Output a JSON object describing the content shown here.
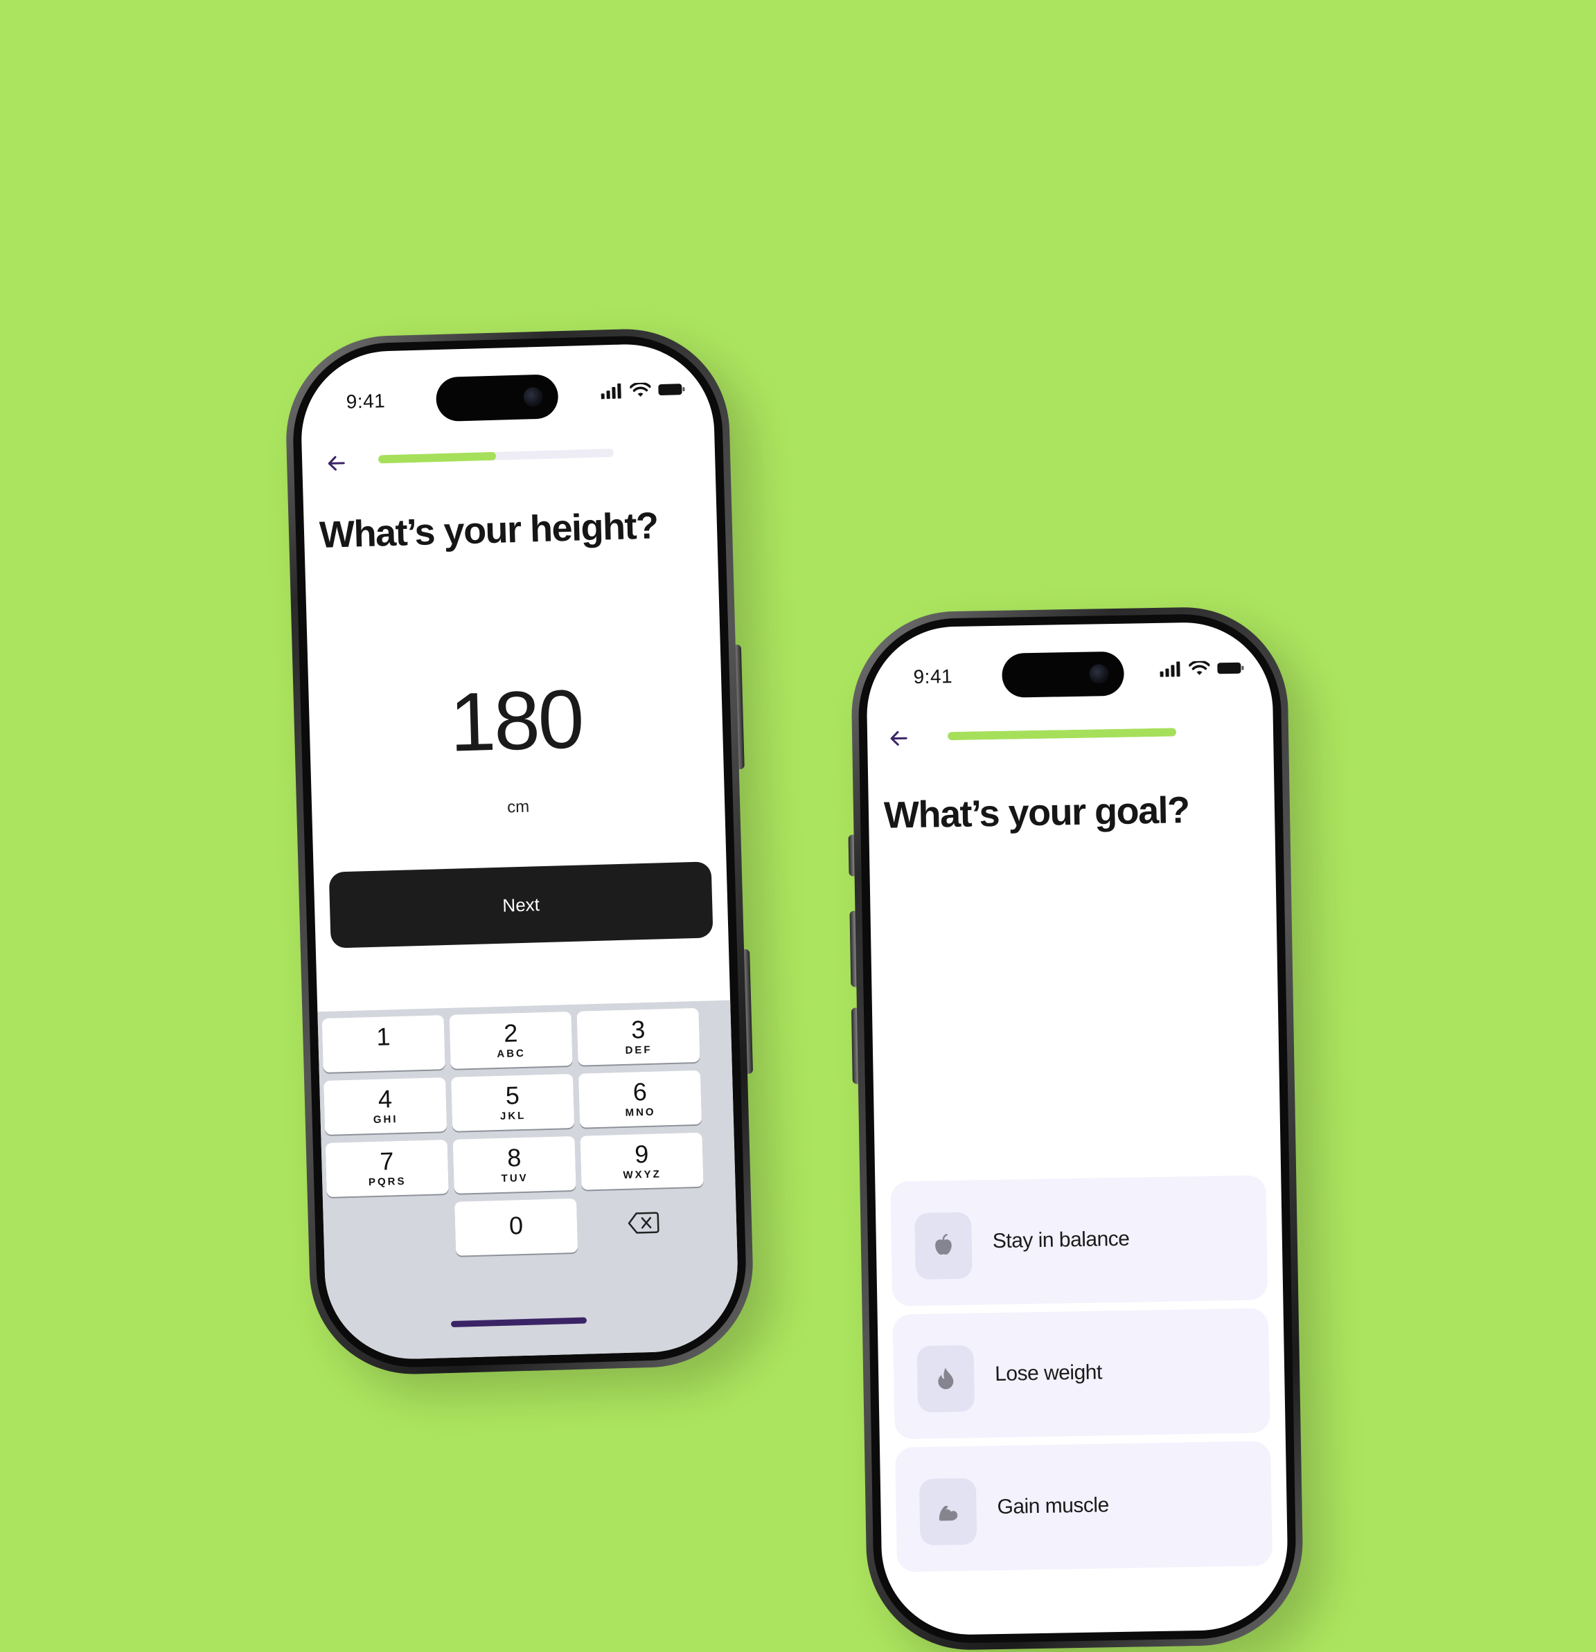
{
  "colors": {
    "background": "#abe45e",
    "accent": "#a6e05a",
    "button": "#1c1c1c",
    "option_bg": "#f3f2fd",
    "home_indicator": "#3b2466"
  },
  "phone_height": {
    "status": {
      "time": "9:41"
    },
    "progress": 0.5,
    "title": "What’s your height?",
    "value": "180",
    "unit": "cm",
    "next_label": "Next",
    "keypad": [
      {
        "num": "1",
        "letters": ""
      },
      {
        "num": "2",
        "letters": "ABC"
      },
      {
        "num": "3",
        "letters": "DEF"
      },
      {
        "num": "4",
        "letters": "GHI"
      },
      {
        "num": "5",
        "letters": "JKL"
      },
      {
        "num": "6",
        "letters": "MNO"
      },
      {
        "num": "7",
        "letters": "PQRS"
      },
      {
        "num": "8",
        "letters": "TUV"
      },
      {
        "num": "9",
        "letters": "WXYZ"
      },
      {
        "num": "0",
        "letters": ""
      }
    ]
  },
  "phone_goal": {
    "status": {
      "time": "9:41"
    },
    "progress": 1.0,
    "title": "What’s your goal?",
    "options": [
      {
        "label": "Stay in balance",
        "icon": "apple-icon"
      },
      {
        "label": "Lose weight",
        "icon": "flame-icon"
      },
      {
        "label": "Gain muscle",
        "icon": "muscle-icon"
      }
    ]
  }
}
